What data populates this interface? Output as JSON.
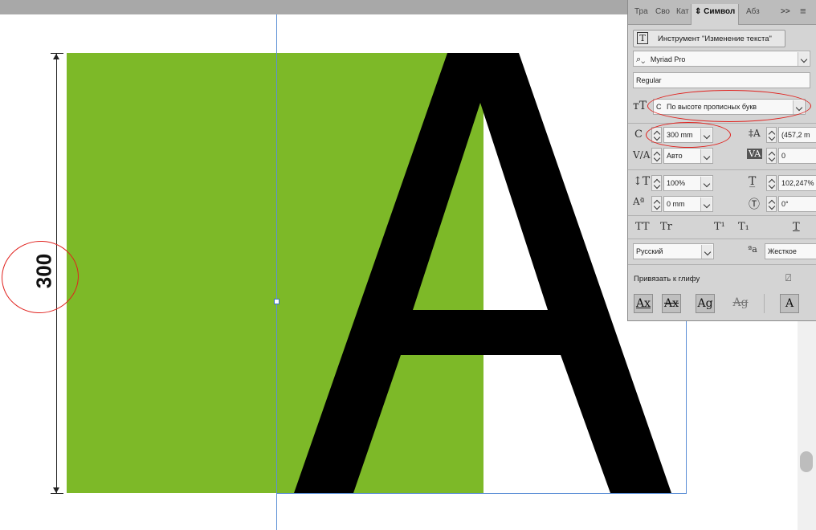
{
  "canvas": {
    "dimension_label": "300",
    "glyph": "A",
    "green_color": "#7db928",
    "guide_color": "#5b8fd6"
  },
  "panel": {
    "tabs": [
      "Тра",
      "Сво",
      "Кат",
      "Символ",
      "Абз"
    ],
    "active_tab": "Символ",
    "collapse_label": ">>",
    "menu_label": "≡",
    "tool_button": "Инструмент \"Изменение текста\"",
    "font_family": "Myriad Pro",
    "font_style": "Regular",
    "size_mode": "По высоте прописных букв",
    "font_size": "300 mm",
    "leading": "(457,2 m",
    "kerning": "Авто",
    "tracking": "0",
    "vertical_scale": "100%",
    "horizontal_scale": "102,247%",
    "baseline_shift": "0 mm",
    "rotation": "0°",
    "language": "Русский",
    "antialias": "Жесткое",
    "snap_to_glyph": "Привязать к глифу",
    "caps_buttons": [
      "TT",
      "Tr",
      "T¹",
      "T₁",
      "T"
    ],
    "glyph_buttons": [
      "Ax",
      "Ax",
      "Ag",
      "Ag",
      "A"
    ]
  },
  "annotations": {
    "color": "#e0221e"
  }
}
